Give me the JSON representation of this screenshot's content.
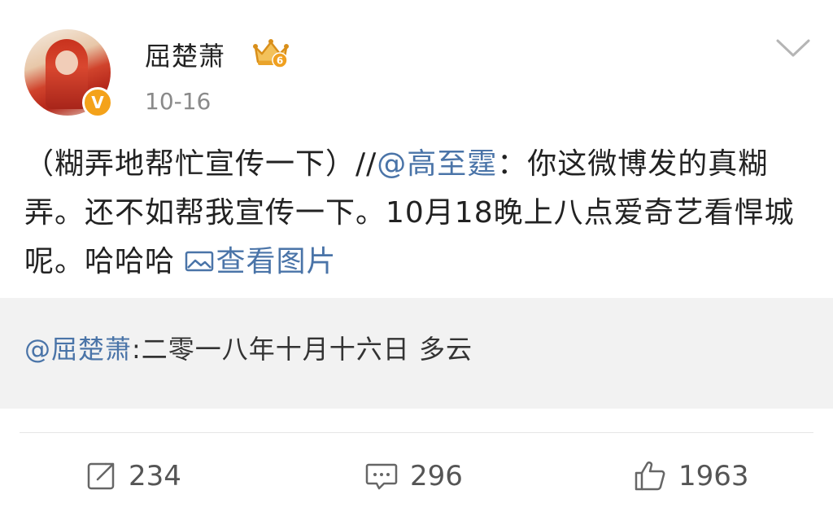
{
  "post": {
    "author_name": "屈楚萧",
    "time": "10-16",
    "content": {
      "prefix": "（糊弄地帮忙宣传一下）//",
      "mention": "@高至霆",
      "body": "：你这微博发的真糊弄。还不如帮我宣传一下。10月18晚上八点爱奇艺看悍城呢。哈哈哈",
      "view_pic_label": "查看图片"
    },
    "verified_badge": "V",
    "level_badge": "6"
  },
  "quote": {
    "mention": "@屈楚萧",
    "text": ":二零一八年十月十六日 多云"
  },
  "actions": {
    "repost_count": "234",
    "comment_count": "296",
    "like_count": "1963"
  },
  "colors": {
    "link": "#4a74a8",
    "verified": "#f4a21a",
    "crown": "#e9a32a",
    "quote_bg": "#f2f2f2"
  },
  "icons": [
    "crown-icon",
    "verified-icon",
    "chevron-down-icon",
    "picture-icon",
    "repost-icon",
    "comment-icon",
    "like-icon"
  ]
}
